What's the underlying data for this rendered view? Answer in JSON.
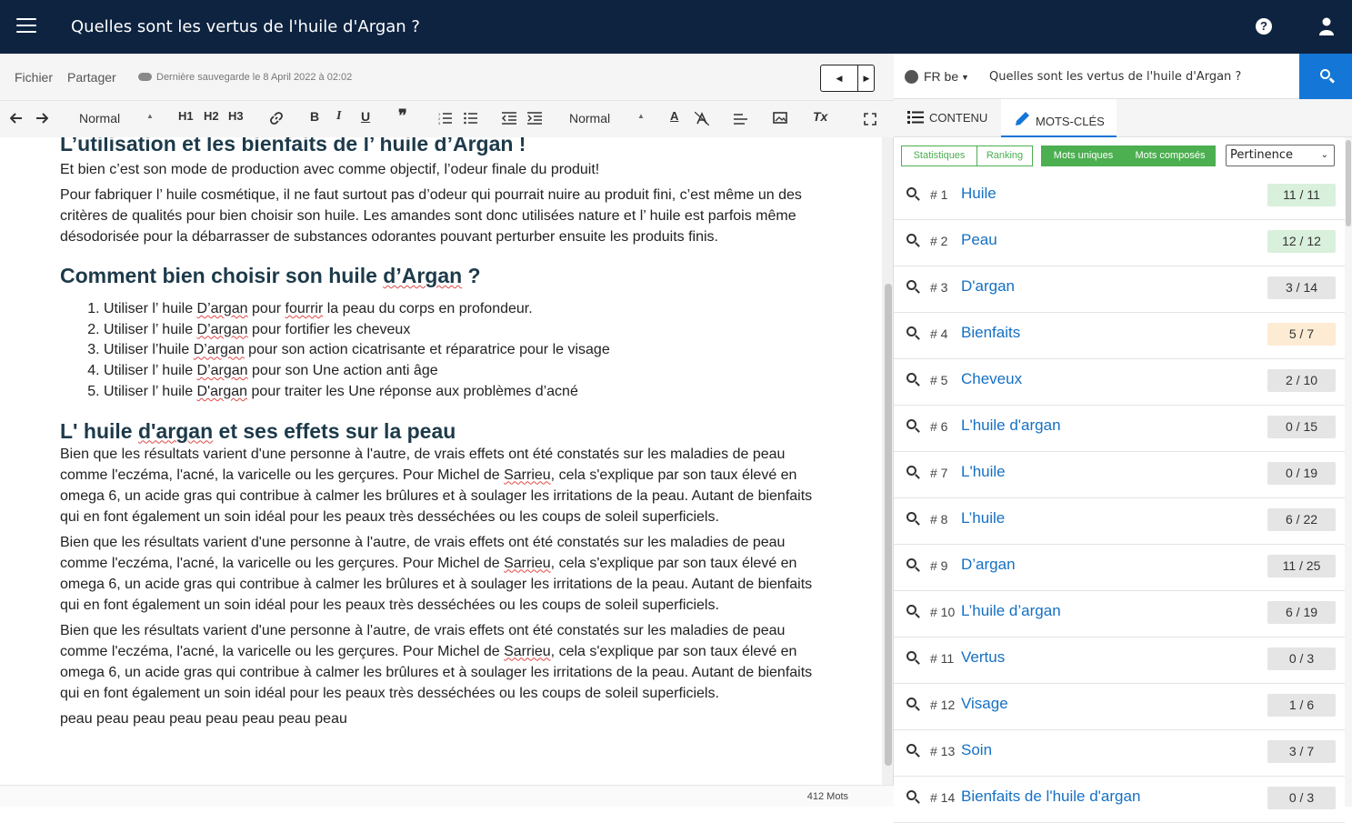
{
  "header": {
    "title": "Quelles sont les vertus de l'huile d'Argan ?"
  },
  "menu": {
    "file": "Fichier",
    "share": "Partager",
    "save_status": "Dernière sauvegarde le 8 April 2022 à 02:02"
  },
  "toolbar": {
    "paragraph_style": "Normal",
    "h1": "H1",
    "h2": "H2",
    "h3": "H3",
    "bold": "B",
    "italic": "I",
    "underline": "U",
    "quote": "❞",
    "font_size": "Normal",
    "text_color": "A",
    "image_icon": "image-icon",
    "clear_format": "Tx"
  },
  "editor": {
    "h2_cut": "L’utilisation et les bienfaits de l’ huile d’Argan !",
    "p_intro": "Et bien c’est son mode de production avec comme objectif, l’odeur finale du produit!",
    "p_fabrication": "Pour fabriquer l’ huile cosmétique, il ne faut surtout pas d’odeur qui pourrait nuire au produit fini, c’est même un des critères de qualités pour bien choisir son huile. Les amandes sont donc utilisées nature et l’ huile est parfois même désodorisée pour la débarrasser de substances odorantes pouvant perturber ensuite les produits finis.",
    "h2_choose_pre": "Comment bien choisir son huile ",
    "h2_choose_sq": "d’Argan",
    "h2_choose_post": " ?",
    "list": [
      {
        "pre": "Utiliser l’ huile ",
        "sq": "D’argan",
        "mid": " pour ",
        "sq2": "fourrir",
        "post": " la peau du corps en profondeur."
      },
      {
        "pre": "Utiliser l’ huile ",
        "sq": "D’argan",
        "mid": " pour fortifier les cheveux",
        "sq2": "",
        "post": ""
      },
      {
        "pre": "Utiliser l’huile ",
        "sq": "D’argan",
        "mid": " pour son action cicatrisante et réparatrice pour le visage",
        "sq2": "",
        "post": ""
      },
      {
        "pre": "Utiliser l’ huile ",
        "sq": "D’argan",
        "mid": " pour son Une action anti âge",
        "sq2": "",
        "post": ""
      },
      {
        "pre": "Utiliser l’ huile ",
        "sq": "D'argan",
        "mid": " pour traiter les Une réponse aux problèmes d’acné",
        "sq2": "",
        "post": ""
      }
    ],
    "h2_effects_pre": "L' huile ",
    "h2_effects_sq": "d'argan",
    "h2_effects_post": " et ses effets sur la peau",
    "p_results_a": "Bien que les résultats varient d'une personne à l'autre, de vrais effets ont été constatés sur les maladies de peau comme l'eczéma, l'acné, la varicelle ou les gerçures. Pour Michel de ",
    "p_results_sq": "Sarrieu",
    "p_results_b": ", cela s'explique par son taux élevé en omega 6, un acide gras qui contribue à calmer les brûlures et à soulager les irritations de la peau. Autant de bienfaits qui en font également un soin idéal pour les peaux très desséchées ou les coups de soleil superficiels.",
    "p_last": "peau peau peau peau peau peau peau peau"
  },
  "status": {
    "word_count": "412 Mots"
  },
  "right": {
    "lang": "FR be",
    "query": "Quelles sont les vertus de l'huile d'Argan ?",
    "tab_content": "CONTENU",
    "tab_keywords": "MOTS-CLÉS",
    "filter_stats": "Statistiques",
    "filter_ranking": "Ranking",
    "filter_unique": "Mots uniques",
    "filter_compound": "Mots composés",
    "sort_select": "Pertinence"
  },
  "keywords": [
    {
      "rank": "# 1",
      "term": "Huile",
      "count": "11 / 11",
      "color": "green"
    },
    {
      "rank": "# 2",
      "term": "Peau",
      "count": "12 / 12",
      "color": "green"
    },
    {
      "rank": "# 3",
      "term": "D'argan",
      "count": "3 / 14",
      "color": "gray"
    },
    {
      "rank": "# 4",
      "term": "Bienfaits",
      "count": "5 / 7",
      "color": "orange"
    },
    {
      "rank": "# 5",
      "term": "Cheveux",
      "count": "2 / 10",
      "color": "gray"
    },
    {
      "rank": "# 6",
      "term": "L'huile d'argan",
      "count": "0 / 15",
      "color": "gray"
    },
    {
      "rank": "# 7",
      "term": "L'huile",
      "count": "0 / 19",
      "color": "gray"
    },
    {
      "rank": "# 8",
      "term": "L’huile",
      "count": "6 / 22",
      "color": "gray"
    },
    {
      "rank": "# 9",
      "term": "D’argan",
      "count": "11 / 25",
      "color": "gray"
    },
    {
      "rank": "# 10",
      "term": "L’huile d’argan",
      "count": "6 / 19",
      "color": "gray"
    },
    {
      "rank": "# 11",
      "term": "Vertus",
      "count": "0 / 3",
      "color": "gray"
    },
    {
      "rank": "# 12",
      "term": "Visage",
      "count": "1 / 6",
      "color": "gray"
    },
    {
      "rank": "# 13",
      "term": "Soin",
      "count": "3 / 7",
      "color": "gray"
    },
    {
      "rank": "# 14",
      "term": "Bienfaits de l'huile d'argan",
      "count": "0 / 3",
      "color": "gray"
    }
  ]
}
